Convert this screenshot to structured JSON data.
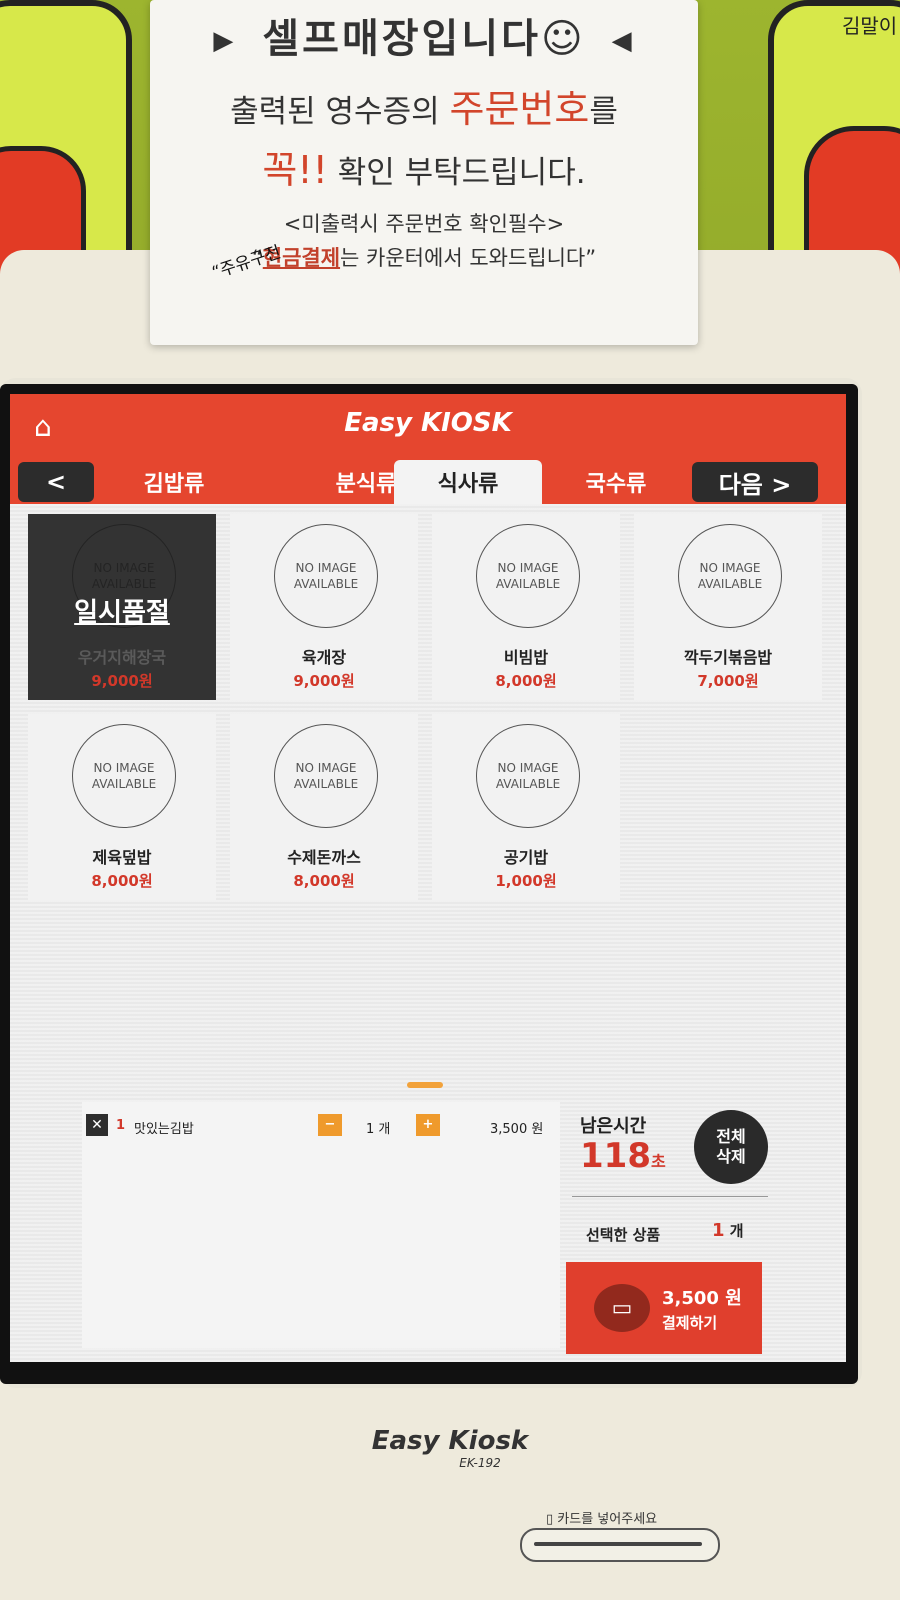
{
  "notice": {
    "line1": "셀프매장입니다☺",
    "line2_a": "출력된 영수증의 ",
    "line2_b": "주문번호",
    "line2_c": "를",
    "line3_a": "꼭!!",
    "line3_b": " 확인 부탁드립니다.",
    "line4": "<미출력시 주문번호 확인필수>",
    "line5_a": "“",
    "line5_b": "현금결제",
    "line5_c": "는 카운터에서 도와드립니다”",
    "handwriting": "“주유구전"
  },
  "mascot_right_text": "김말이",
  "app": {
    "brand": "Easy KIOSK",
    "nav_prev": "<",
    "nav_next": "다음 >",
    "tabs": [
      {
        "label": "김밥류",
        "active": false
      },
      {
        "label": "분식류",
        "active": false
      },
      {
        "label": "식사류",
        "active": true
      },
      {
        "label": "국수류",
        "active": false
      }
    ],
    "placeholder_line1": "NO IMAGE",
    "placeholder_line2": "AVAILABLE",
    "items": [
      {
        "name": "우거지해장국",
        "price": "9,000원",
        "sold_out": true,
        "sold_out_label": "일시품절"
      },
      {
        "name": "육개장",
        "price": "9,000원",
        "sold_out": false
      },
      {
        "name": "비빔밥",
        "price": "8,000원",
        "sold_out": false
      },
      {
        "name": "깍두기볶음밥",
        "price": "7,000원",
        "sold_out": false
      },
      {
        "name": "제육덮밥",
        "price": "8,000원",
        "sold_out": false
      },
      {
        "name": "수제돈까스",
        "price": "8,000원",
        "sold_out": false
      },
      {
        "name": "공기밥",
        "price": "1,000원",
        "sold_out": false
      }
    ],
    "cart": {
      "remove": "✕",
      "index": "1",
      "name": "맛있는김밥",
      "minus": "−",
      "plus": "+",
      "qty": "1 개",
      "price": "3,500 원"
    },
    "timer_label": "남은시간",
    "timer_value": "118",
    "timer_unit": "초",
    "clear_all_l1": "전체",
    "clear_all_l2": "삭제",
    "selected_label": "선택한 상품",
    "selected_count": "1",
    "selected_unit": " 개",
    "pay_amount": "3,500 원",
    "pay_label": "결제하기"
  },
  "device": {
    "brand": "Easy Kiosk",
    "model": "EK-192",
    "card_slot_label": "카드를 넣어주세요"
  },
  "colors": {
    "accent": "#e5462f",
    "price": "#d2382a",
    "qty_btn": "#ef9a2c"
  }
}
